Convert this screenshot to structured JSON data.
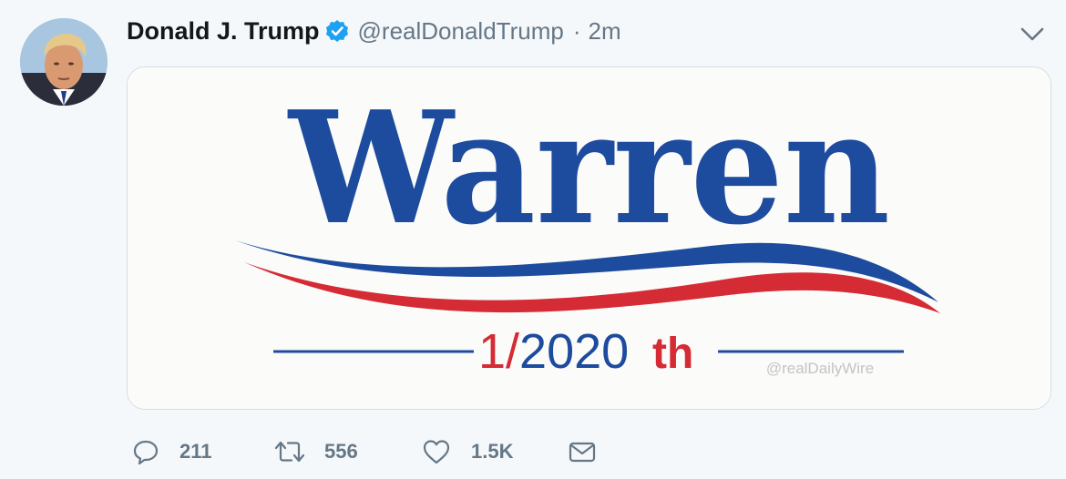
{
  "tweet": {
    "author": {
      "display_name": "Donald J. Trump",
      "handle": "@realDonaldTrump",
      "verified": true,
      "verified_icon": "verified-badge-icon",
      "avatar_icon": "profile-photo"
    },
    "separator": "·",
    "timestamp": "2m",
    "menu_icon": "chevron-down-icon",
    "media": {
      "headline": "Warren",
      "fraction_text": "1/2020",
      "suffix_text": "th",
      "watermark": "@realDailyWire",
      "colors": {
        "blue": "#1d4b9e",
        "red": "#d42b35",
        "background": "#fbfbf9"
      }
    },
    "actions": {
      "reply": {
        "icon": "reply-icon",
        "count": "211"
      },
      "retweet": {
        "icon": "retweet-icon",
        "count": "556"
      },
      "like": {
        "icon": "heart-icon",
        "count": "1.5K"
      },
      "message": {
        "icon": "envelope-icon"
      }
    },
    "colors": {
      "name": "#14171a",
      "secondary": "#657786",
      "verified": "#1da1f2",
      "page_background": "#f5f8fa"
    }
  }
}
